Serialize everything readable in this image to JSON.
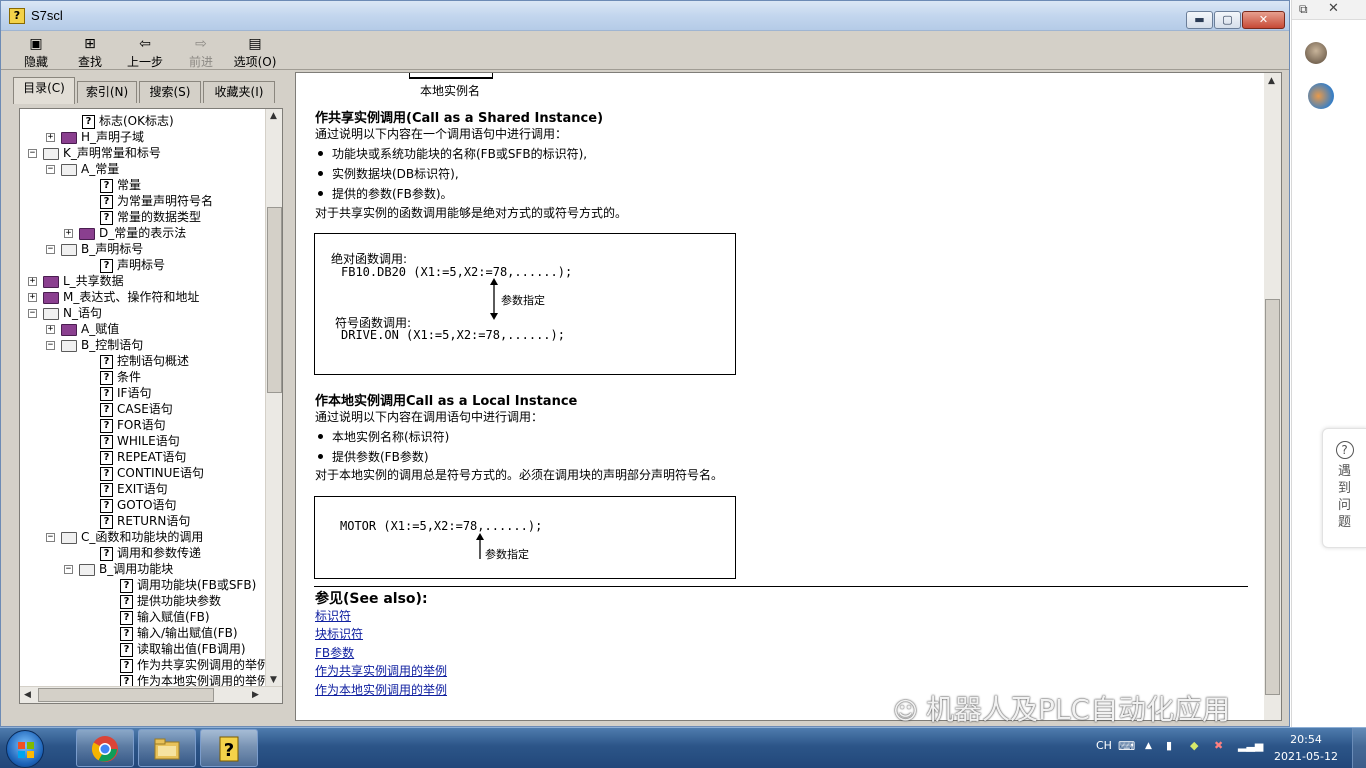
{
  "window": {
    "title": "S7scl",
    "minimize_label": "▬",
    "maximize_label": "▢",
    "close_label": "✕"
  },
  "toolbar": {
    "hide": "隐藏",
    "find": "查找",
    "back": "上一步",
    "forward": "前进",
    "options": "选项(O)"
  },
  "tabs": [
    "目录(C)",
    "索引(N)",
    "搜索(S)",
    "收藏夹(I)"
  ],
  "tree": [
    {
      "label": "标志(OK标志)",
      "kind": "page"
    },
    {
      "label": "H_声明子域",
      "kind": "book",
      "expand": "+"
    },
    {
      "label": "K_声明常量和标号",
      "kind": "openbook",
      "expand": "−"
    },
    {
      "label": "A_常量",
      "kind": "openbook",
      "expand": "−"
    },
    {
      "label": "常量",
      "kind": "page"
    },
    {
      "label": "为常量声明符号名",
      "kind": "page"
    },
    {
      "label": "常量的数据类型",
      "kind": "page"
    },
    {
      "label": "D_常量的表示法",
      "kind": "book",
      "expand": "+"
    },
    {
      "label": "B_声明标号",
      "kind": "openbook",
      "expand": "−"
    },
    {
      "label": "声明标号",
      "kind": "page"
    },
    {
      "label": "L_共享数据",
      "kind": "book",
      "expand": "+"
    },
    {
      "label": "M_表达式、操作符和地址",
      "kind": "book",
      "expand": "+"
    },
    {
      "label": "N_语句",
      "kind": "openbook",
      "expand": "−"
    },
    {
      "label": "A_赋值",
      "kind": "book",
      "expand": "+"
    },
    {
      "label": "B_控制语句",
      "kind": "openbook",
      "expand": "−"
    },
    {
      "label": "控制语句概述",
      "kind": "page"
    },
    {
      "label": "条件",
      "kind": "page"
    },
    {
      "label": "IF语句",
      "kind": "page"
    },
    {
      "label": "CASE语句",
      "kind": "page"
    },
    {
      "label": "FOR语句",
      "kind": "page"
    },
    {
      "label": "WHILE语句",
      "kind": "page"
    },
    {
      "label": "REPEAT语句",
      "kind": "page"
    },
    {
      "label": "CONTINUE语句",
      "kind": "page"
    },
    {
      "label": "EXIT语句",
      "kind": "page"
    },
    {
      "label": "GOTO语句",
      "kind": "page"
    },
    {
      "label": "RETURN语句",
      "kind": "page"
    },
    {
      "label": "C_函数和功能块的调用",
      "kind": "openbook",
      "expand": "−"
    },
    {
      "label": "调用和参数传递",
      "kind": "page"
    },
    {
      "label": "B_调用功能块",
      "kind": "openbook",
      "expand": "−"
    },
    {
      "label": "调用功能块(FB或SFB)",
      "kind": "page"
    },
    {
      "label": "提供功能块参数",
      "kind": "page"
    },
    {
      "label": "输入赋值(FB)",
      "kind": "page"
    },
    {
      "label": "输入/输出赋值(FB)",
      "kind": "page"
    },
    {
      "label": "读取输出值(FB调用)",
      "kind": "page"
    },
    {
      "label": "作为共享实例调用的举例",
      "kind": "page"
    },
    {
      "label": "作为本地实例调用的举例",
      "kind": "page"
    }
  ],
  "content": {
    "top_fig_label": "本地实例名",
    "shared_heading": "作共享实例调用(Call as a Shared Instance)",
    "shared_intro": "通过说明以下内容在一个调用语句中进行调用：",
    "shared_bullets": [
      "功能块或系统功能块的名称(FB或SFB的标识符),",
      "实例数据块(DB标识符),",
      "提供的参数(FB参数)。"
    ],
    "shared_note": "对于共享实例的函数调用能够是绝对方式的或符号方式的。",
    "box1": {
      "abs_label": "绝对函数调用:",
      "abs_code": "FB10.DB20 (X1:=5,X2:=78,......);",
      "param_label": "参数指定",
      "sym_label": "符号函数调用:",
      "sym_code": "DRIVE.ON (X1:=5,X2:=78,......);"
    },
    "local_heading": "作本地实例调用Call as a Local Instance",
    "local_intro": "通过说明以下内容在调用语句中进行调用：",
    "local_bullets": [
      "本地实例名称(标识符)",
      "提供参数(FB参数)"
    ],
    "local_note": "对于本地实例的调用总是符号方式的。必须在调用块的声明部分声明符号名。",
    "box2": {
      "code": "MOTOR (X1:=5,X2:=78,......);",
      "param_label": "参数指定"
    },
    "see_also": "参见(See also):",
    "links": [
      "标识符",
      "块标识符",
      "FB参数",
      "作为共享实例调用的举例",
      "作为本地实例调用的举例"
    ]
  },
  "side_panel": {
    "help_icon": "?",
    "help_text": [
      "遇",
      "到",
      "问",
      "题"
    ]
  },
  "watermark": "机器人及PLC自动化应用",
  "taskbar": {
    "lang": "CH",
    "time": "20:54",
    "date": "2021-05-12"
  }
}
